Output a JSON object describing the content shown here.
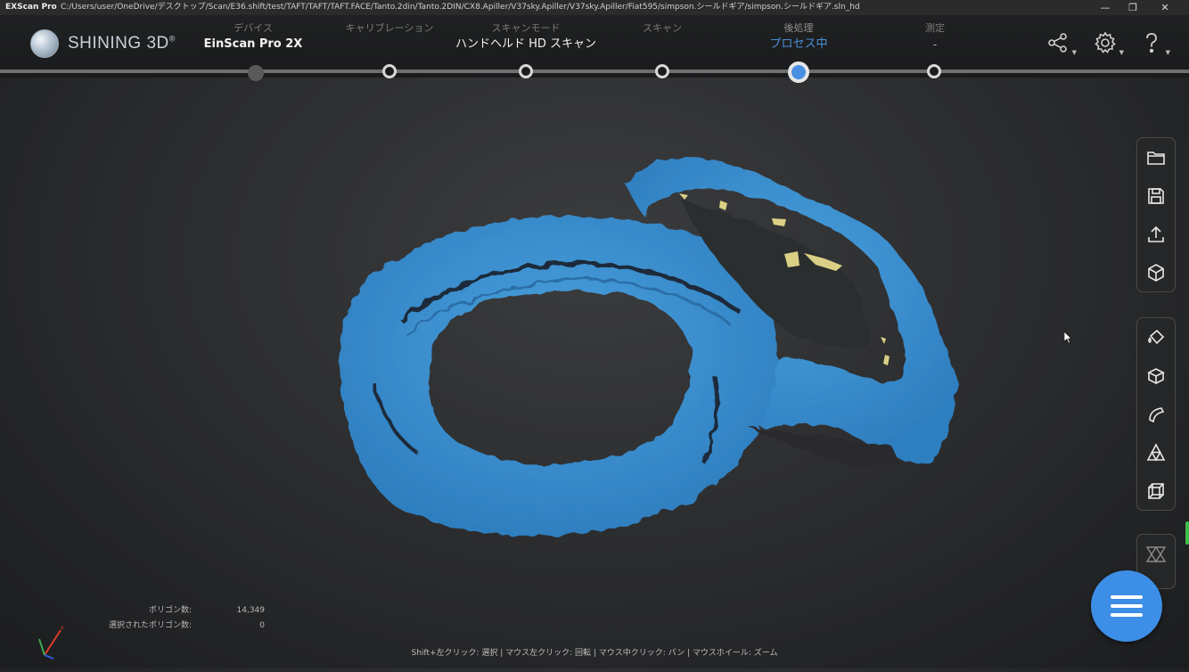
{
  "window": {
    "app_name": "EXScan Pro",
    "path": "C:/Users/user/OneDrive/デスクトップ/Scan/E36.shift/test/TAFT/TAFT/TAFT.FACE/Tanto.2din/Tanto.2DIN/CX8.Apiller/V37sky.Apiller/V37sky.Apiller/Fiat595/simpson.シールドギア/simpson.シールドギア.sln_hd",
    "minimize": "—",
    "maximize": "❐",
    "close": "✕"
  },
  "header": {
    "logo_text": "SHINING 3D",
    "logo_mark": "®",
    "steps": [
      {
        "label": "デバイス",
        "value": "EinScan Pro 2X"
      },
      {
        "label": "キャリブレーション",
        "value": ""
      },
      {
        "label": "スキャンモード",
        "value": "ハンドヘルド HD スキャン"
      },
      {
        "label": "スキャン",
        "value": ""
      },
      {
        "label": "後処理",
        "value": "プロセス中"
      },
      {
        "label": "測定",
        "value": "-"
      }
    ],
    "active_step": 4,
    "icons": [
      "share-icon",
      "gear-icon",
      "help-icon"
    ]
  },
  "toolbar_top": [
    "open-folder-icon",
    "save-icon",
    "export-icon",
    "model-cube-icon"
  ],
  "toolbar_mid": [
    "fill-bucket-icon",
    "box-icon",
    "curve-icon",
    "triangle-mesh-icon",
    "wireframe-cube-icon"
  ],
  "toolbar_bottom": [
    "mesh-overlay-icon"
  ],
  "stats": {
    "polygons_label": "ポリゴン数:",
    "polygons_value": "14,349",
    "selected_label": "選択されたポリゴン数:",
    "selected_value": "0"
  },
  "hint": "Shift+左クリック: 選択 | マウス左クリック: 回転 | マウス中クリック: パン | マウスホイール: ズーム",
  "colors": {
    "mesh": "#3a8fd0",
    "mesh_highlight": "#e4d98a",
    "accent": "#3d8ee6",
    "active_step": "#4a90e2"
  }
}
